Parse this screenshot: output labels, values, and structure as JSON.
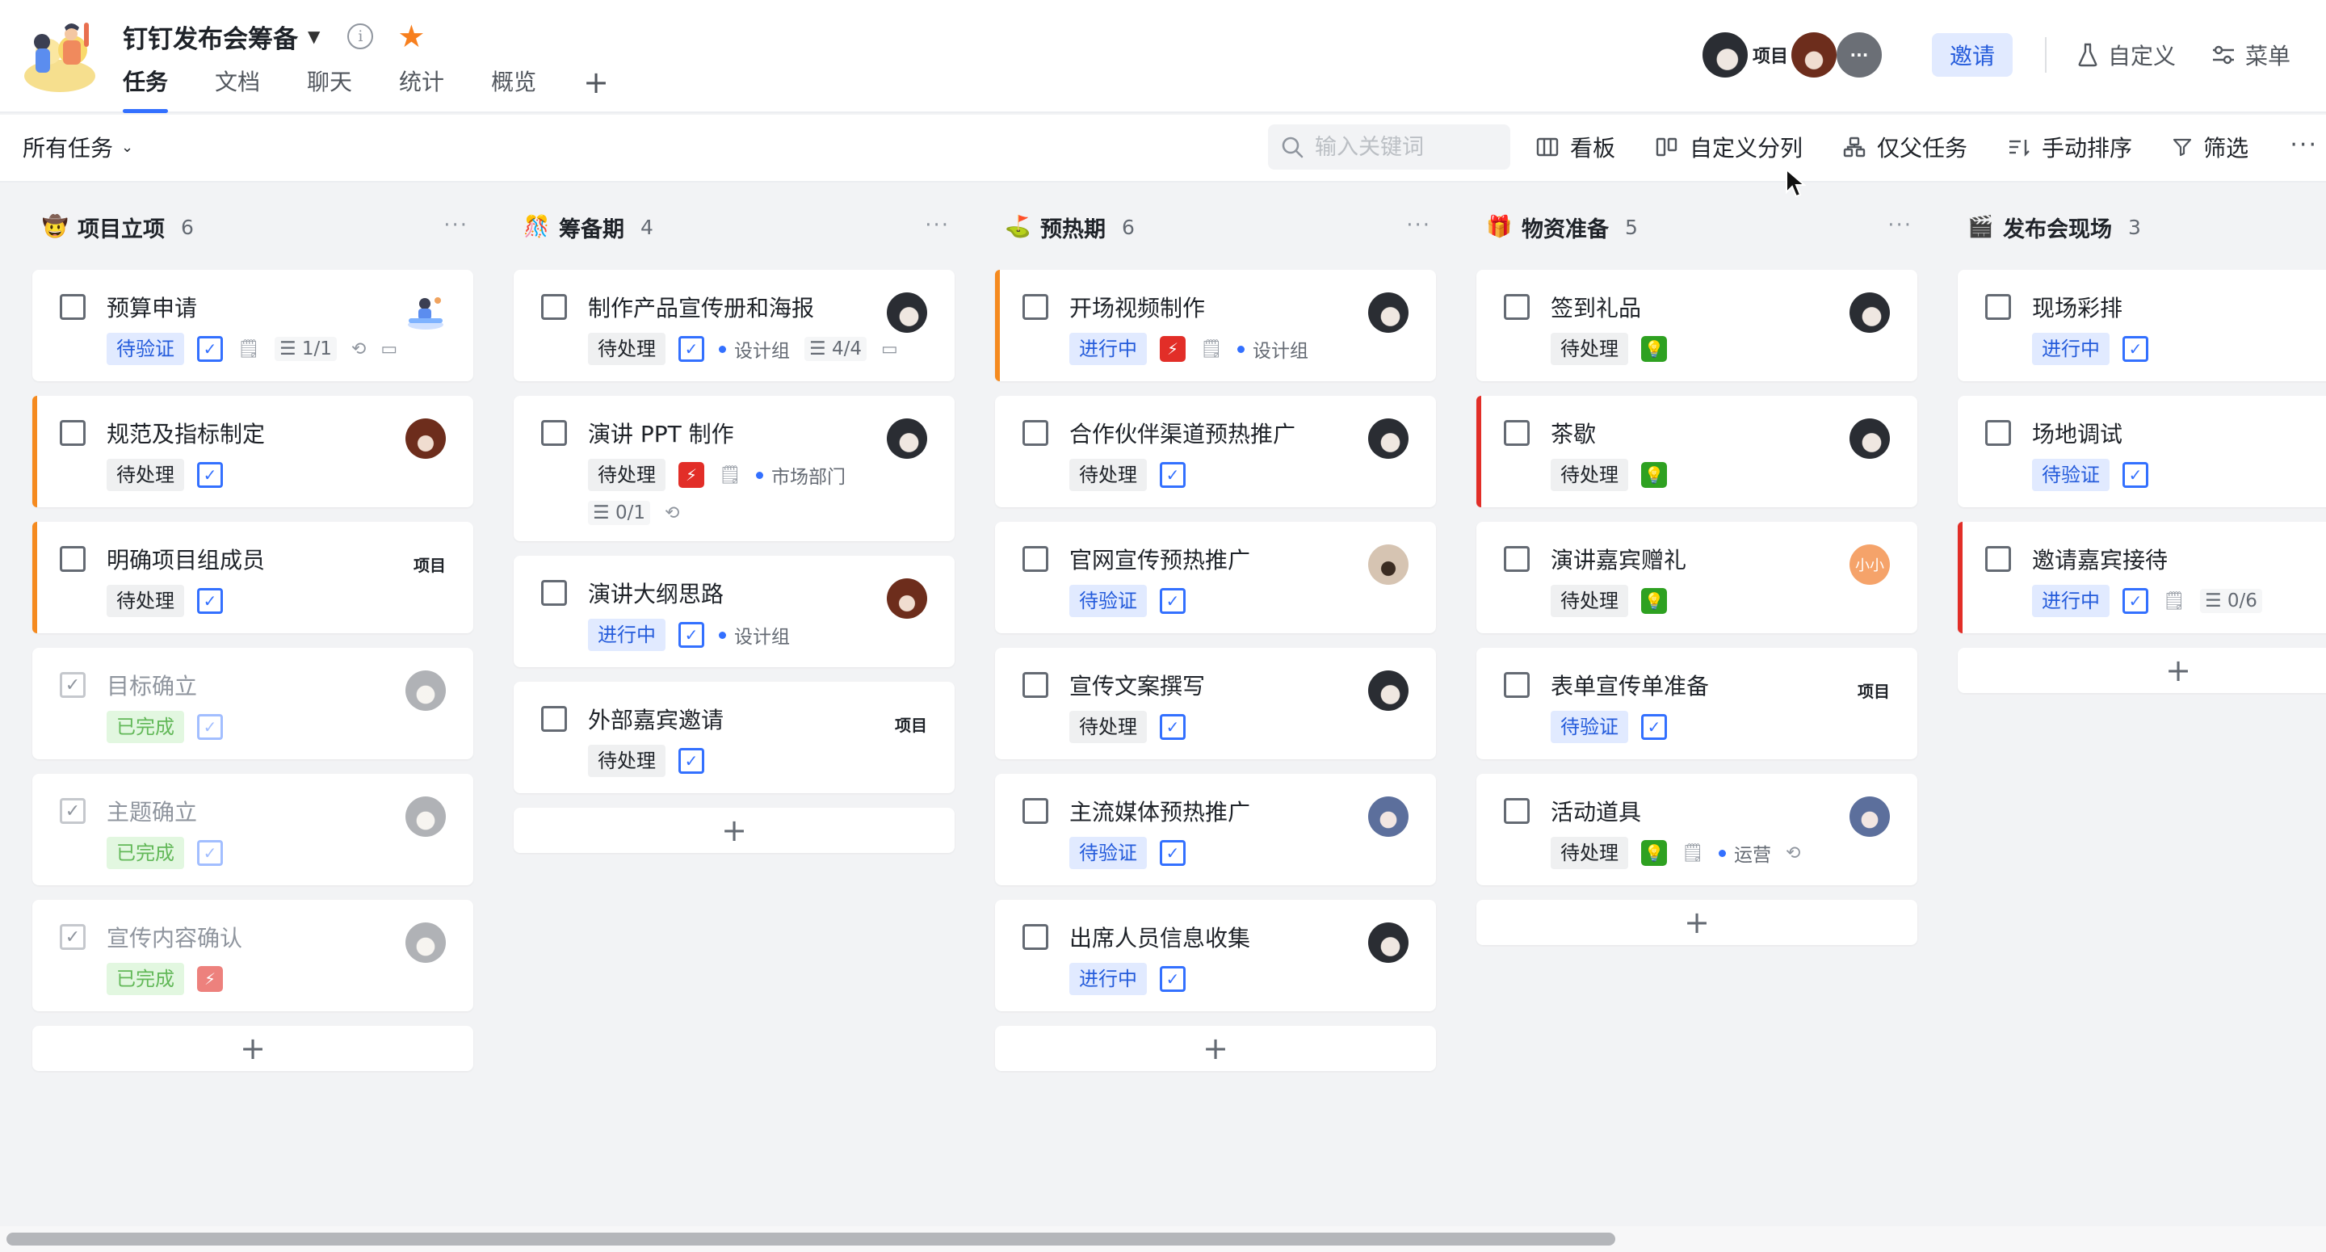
{
  "header": {
    "title": "钉钉发布会筹备",
    "tabs": [
      "任务",
      "文档",
      "聊天",
      "统计",
      "概览"
    ],
    "active_tab": 0,
    "project_badge": "项目",
    "more_avatar": "···",
    "invite": "邀请",
    "customize": "自定义",
    "menu": "菜单",
    "icons": {
      "info": "info-icon",
      "star": "star-icon",
      "add_tab": "plus-icon",
      "customize": "flask-icon",
      "menu": "sliders-icon"
    },
    "colors": {
      "accent": "#3370ff",
      "star": "#f77f1e"
    }
  },
  "toolbar": {
    "all_tasks": "所有任务",
    "search_placeholder": "输入关键词",
    "tools": [
      "看板",
      "自定义分列",
      "仅父任务",
      "手动排序",
      "筛选"
    ],
    "more": "···"
  },
  "columns": [
    {
      "emoji": "🤠",
      "title": "项目立项",
      "count": "6",
      "more": "···",
      "cards": [
        {
          "title": "预算申请",
          "avatar": "illus",
          "bar": "",
          "done": false,
          "status": "待验证",
          "status_color": "blue",
          "priority": "check",
          "meta": {
            "doc": true,
            "sub": "1/1",
            "repeat": true,
            "comment": true
          }
        },
        {
          "title": "规范及指标制定",
          "avatar": "brown",
          "bar": "orange",
          "done": false,
          "status": "待处理",
          "status_color": "gray",
          "priority": "check",
          "meta": {}
        },
        {
          "title": "明确项目组成员",
          "avatar": "project",
          "project_label": "项目",
          "bar": "orange",
          "done": false,
          "status": "待处理",
          "status_color": "gray",
          "priority": "check",
          "meta": {}
        },
        {
          "title": "目标确立",
          "avatar": "light",
          "bar": "",
          "done": true,
          "status": "已完成",
          "status_color": "green",
          "priority": "check",
          "meta": {}
        },
        {
          "title": "主题确立",
          "avatar": "light",
          "bar": "",
          "done": true,
          "status": "已完成",
          "status_color": "green",
          "priority": "check",
          "meta": {}
        },
        {
          "title": "宣传内容确认",
          "avatar": "light",
          "bar": "",
          "done": true,
          "status": "已完成",
          "status_color": "green",
          "priority": "bolt",
          "meta": {}
        }
      ]
    },
    {
      "emoji": "🎊",
      "title": "筹备期",
      "count": "4",
      "more": "···",
      "cards": [
        {
          "title": "制作产品宣传册和海报",
          "avatar": "dark",
          "bar": "",
          "done": false,
          "status": "待处理",
          "status_color": "gray",
          "priority": "check",
          "meta": {
            "group": "设计组",
            "sub": "4/4",
            "comment": true
          }
        },
        {
          "title": "演讲 PPT 制作",
          "avatar": "dark",
          "bar": "",
          "done": false,
          "status": "待处理",
          "status_color": "gray",
          "priority": "bolt",
          "meta": {
            "doc": true,
            "group": "市场部门",
            "sub": "0/1",
            "repeat": true
          }
        },
        {
          "title": "演讲大纲思路",
          "avatar": "brown",
          "bar": "",
          "done": false,
          "status": "进行中",
          "status_color": "blue",
          "priority": "check",
          "meta": {
            "group": "设计组"
          }
        },
        {
          "title": "外部嘉宾邀请",
          "avatar": "project",
          "project_label": "项目",
          "bar": "",
          "done": false,
          "status": "待处理",
          "status_color": "gray",
          "priority": "check",
          "meta": {}
        }
      ]
    },
    {
      "emoji": "⛳",
      "title": "预热期",
      "count": "6",
      "more": "···",
      "cards": [
        {
          "title": "开场视频制作",
          "avatar": "dark",
          "bar": "orange",
          "done": false,
          "status": "进行中",
          "status_color": "blue",
          "priority": "bolt",
          "meta": {
            "doc": true,
            "group": "设计组"
          }
        },
        {
          "title": "合作伙伴渠道预热推广",
          "avatar": "dark",
          "bar": "",
          "done": false,
          "status": "待处理",
          "status_color": "gray",
          "priority": "check",
          "meta": {}
        },
        {
          "title": "官网宣传预热推广",
          "avatar": "beige",
          "bar": "",
          "done": false,
          "status": "待验证",
          "status_color": "blue",
          "priority": "check",
          "meta": {}
        },
        {
          "title": "宣传文案撰写",
          "avatar": "dark",
          "bar": "",
          "done": false,
          "status": "待处理",
          "status_color": "gray",
          "priority": "check",
          "meta": {}
        },
        {
          "title": "主流媒体预热推广",
          "avatar": "blue",
          "bar": "",
          "done": false,
          "status": "待验证",
          "status_color": "blue",
          "priority": "check",
          "meta": {}
        },
        {
          "title": "出席人员信息收集",
          "avatar": "dark",
          "bar": "",
          "done": false,
          "status": "进行中",
          "status_color": "blue",
          "priority": "check",
          "meta": {}
        }
      ]
    },
    {
      "emoji": "🎁",
      "title": "物资准备",
      "count": "5",
      "more": "···",
      "cards": [
        {
          "title": "签到礼品",
          "avatar": "dark",
          "bar": "",
          "done": false,
          "status": "待处理",
          "status_color": "gray",
          "priority": "bulb",
          "meta": {}
        },
        {
          "title": "茶歇",
          "avatar": "dark",
          "bar": "red",
          "done": false,
          "status": "待处理",
          "status_color": "gray",
          "priority": "bulb",
          "meta": {}
        },
        {
          "title": "演讲嘉宾赠礼",
          "avatar": "orange",
          "avatar_text": "小小",
          "bar": "",
          "done": false,
          "status": "待处理",
          "status_color": "gray",
          "priority": "bulb",
          "meta": {}
        },
        {
          "title": "表单宣传单准备",
          "avatar": "project",
          "project_label": "项目",
          "bar": "",
          "done": false,
          "status": "待验证",
          "status_color": "blue",
          "priority": "check",
          "meta": {}
        },
        {
          "title": "活动道具",
          "avatar": "blue",
          "bar": "",
          "done": false,
          "status": "待处理",
          "status_color": "gray",
          "priority": "bulb",
          "meta": {
            "doc": true,
            "group": "运营",
            "repeat": true
          }
        }
      ]
    },
    {
      "emoji": "🎬",
      "title": "发布会现场",
      "count": "3",
      "more": "···",
      "cards": [
        {
          "title": "现场彩排",
          "avatar": "",
          "bar": "",
          "done": false,
          "status": "进行中",
          "status_color": "blue",
          "priority": "check",
          "meta": {}
        },
        {
          "title": "场地调试",
          "avatar": "",
          "bar": "",
          "done": false,
          "status": "待验证",
          "status_color": "blue",
          "priority": "check",
          "meta": {}
        },
        {
          "title": "邀请嘉宾接待",
          "avatar": "",
          "bar": "red",
          "done": false,
          "status": "进行中",
          "status_color": "blue",
          "priority": "check",
          "meta": {
            "doc": true,
            "sub": "0/6"
          }
        }
      ]
    }
  ]
}
